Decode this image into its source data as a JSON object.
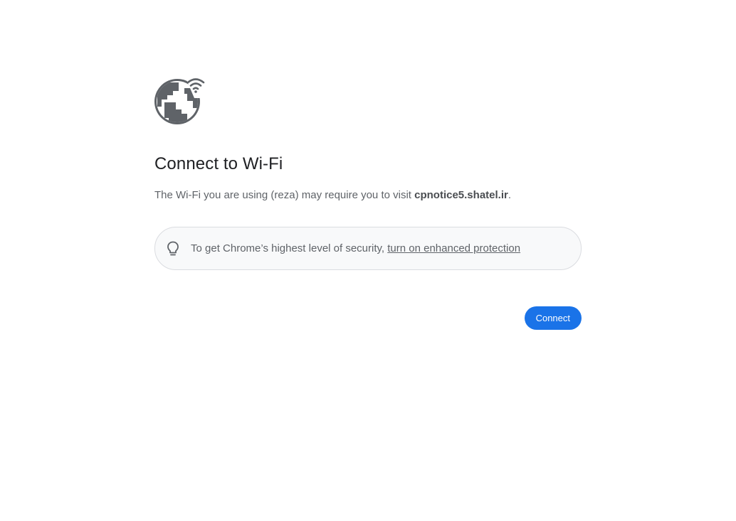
{
  "page": {
    "title": "Connect to Wi-Fi",
    "message_prefix": "The Wi-Fi you are using (reza) may require you to visit ",
    "domain": "cpnotice5.shatel.ir",
    "message_suffix": ".",
    "hero_icon": "globe-wifi-icon"
  },
  "promo": {
    "icon": "lightbulb-icon",
    "text": "To get Chrome’s highest level of security, ",
    "link_label": "turn on enhanced protection"
  },
  "actions": {
    "connect_label": "Connect"
  },
  "colors": {
    "icon_gray": "#5f6368",
    "title": "#202124",
    "body_text": "#5f6368",
    "promo_bg": "#f8f9fa",
    "promo_border": "#dadce0",
    "button_bg": "#1a73e8",
    "button_text": "#ffffff"
  }
}
